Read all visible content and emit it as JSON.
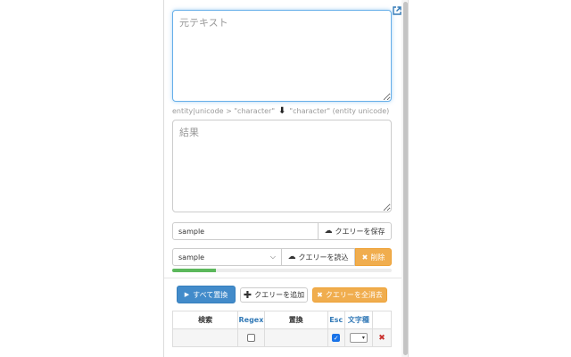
{
  "source": {
    "placeholder": "元テキスト",
    "value": ""
  },
  "conversion_hint": {
    "left": "entity|unicode > \"character\"",
    "arrow": "🡇",
    "right": "\"character\" (entity unicode)"
  },
  "result": {
    "placeholder": "結果",
    "value": ""
  },
  "save": {
    "input_value": "sample",
    "button_label": "クエリーを保存",
    "icon": "cloud-upload-icon"
  },
  "load": {
    "selected": "sample",
    "button_label": "クエリーを読込",
    "icon": "cloud-download-icon",
    "delete_label": "削除"
  },
  "progress": {
    "fraction": 0.2,
    "color": "#5cb85c"
  },
  "actions": {
    "replace_all": "すべて置換",
    "add_query": "クエリーを追加",
    "clear_queries": "クエリーを全消去"
  },
  "table": {
    "headers": [
      "検索",
      "Regex",
      "置換",
      "Esc",
      "文字種",
      ""
    ],
    "rows": [
      {
        "search": "",
        "regex": false,
        "replace": "",
        "esc": true,
        "char_type": ""
      }
    ]
  },
  "colors": {
    "primary": "#428bca",
    "warning": "#f0ad4e",
    "link": "#337ab7",
    "success": "#5cb85c"
  }
}
